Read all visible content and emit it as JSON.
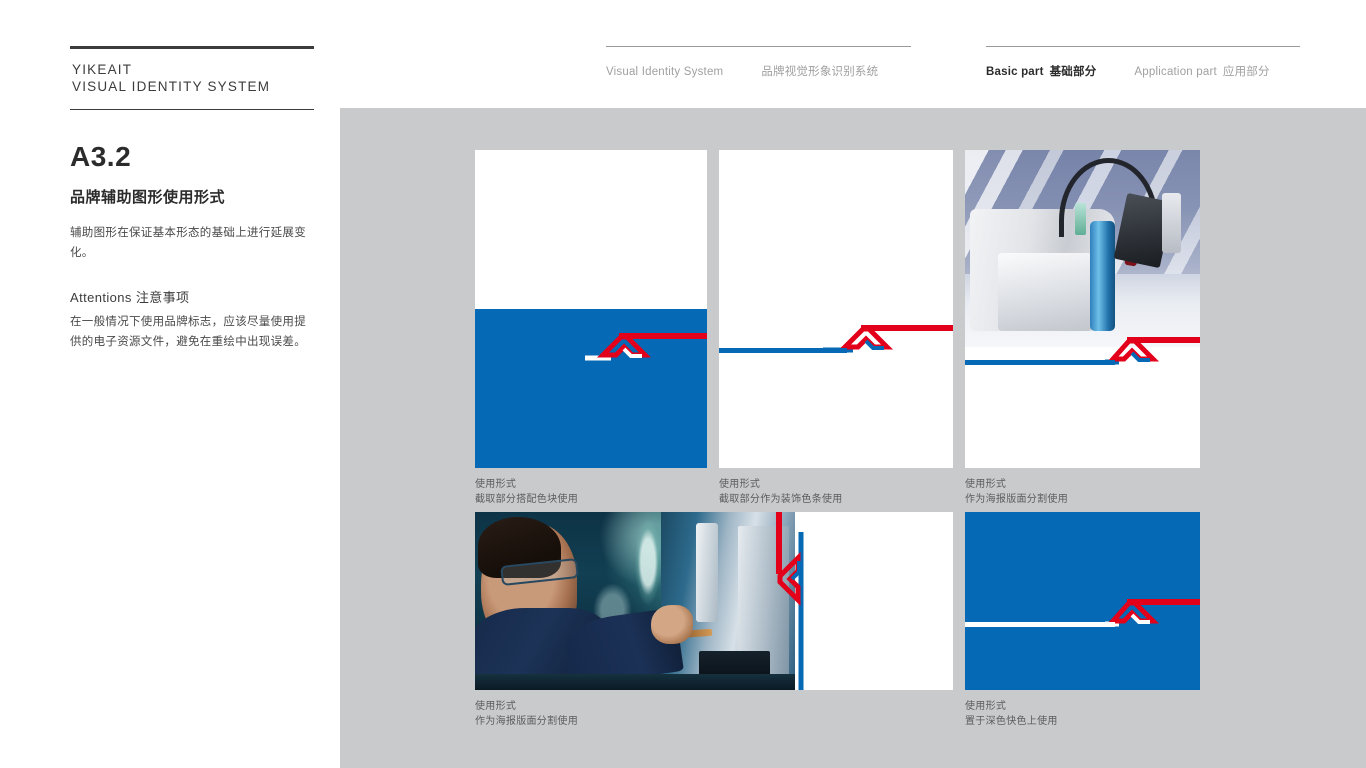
{
  "brand": {
    "line1": "YIKEAIT",
    "line2": "VISUAL IDENTITY SYSTEM"
  },
  "nav": {
    "left": [
      {
        "en": "Visual Identity System",
        "cn": "",
        "active": false
      },
      {
        "en": "",
        "cn": "品牌视觉形象识别系统",
        "active": false
      }
    ],
    "right": [
      {
        "en": "Basic part",
        "cn": "基础部分",
        "active": true
      },
      {
        "en": "Application part",
        "cn": "应用部分",
        "active": false
      }
    ]
  },
  "sidebar": {
    "section_code": "A3.2",
    "section_title": "品牌辅助图形使用形式",
    "description": "辅助图形在保证基本形态的基础上进行延展变化。",
    "attentions_label_en": "Attentions",
    "attentions_label_cn": "注意事项",
    "attentions_body": "在一般情况下使用品牌标志，应该尽量使用提供的电子资源文件，避免在重绘中出现误差。"
  },
  "colors": {
    "brand_blue": "#0569b5",
    "brand_red": "#e2001a",
    "panel_gray": "#c9cacc",
    "text_dark": "#2b2b2b",
    "text_muted": "#a0a0a0"
  },
  "cards": [
    {
      "id": "card-1",
      "caption_title": "使用形式",
      "caption_desc": "截取部分搭配色块使用",
      "background": "white-with-blue-block",
      "motif": "horizontal-arrow-red-white"
    },
    {
      "id": "card-2",
      "caption_title": "使用形式",
      "caption_desc": "截取部分作为装饰色条使用",
      "background": "white",
      "motif": "horizontal-arrow-red-blue"
    },
    {
      "id": "card-3",
      "caption_title": "使用形式",
      "caption_desc": "作为海报版面分割使用",
      "background": "photo-robotic-welding-arm",
      "motif": "horizontal-arrow-red-blue"
    },
    {
      "id": "card-4",
      "caption_title": "使用形式",
      "caption_desc": "作为海报版面分割使用",
      "background": "photo-engineer-at-machine",
      "motif": "vertical-arrow-red-blue"
    },
    {
      "id": "card-5",
      "caption_title": "使用形式",
      "caption_desc": "置于深色快色上使用",
      "background": "solid-blue",
      "motif": "horizontal-arrow-red-white"
    }
  ]
}
